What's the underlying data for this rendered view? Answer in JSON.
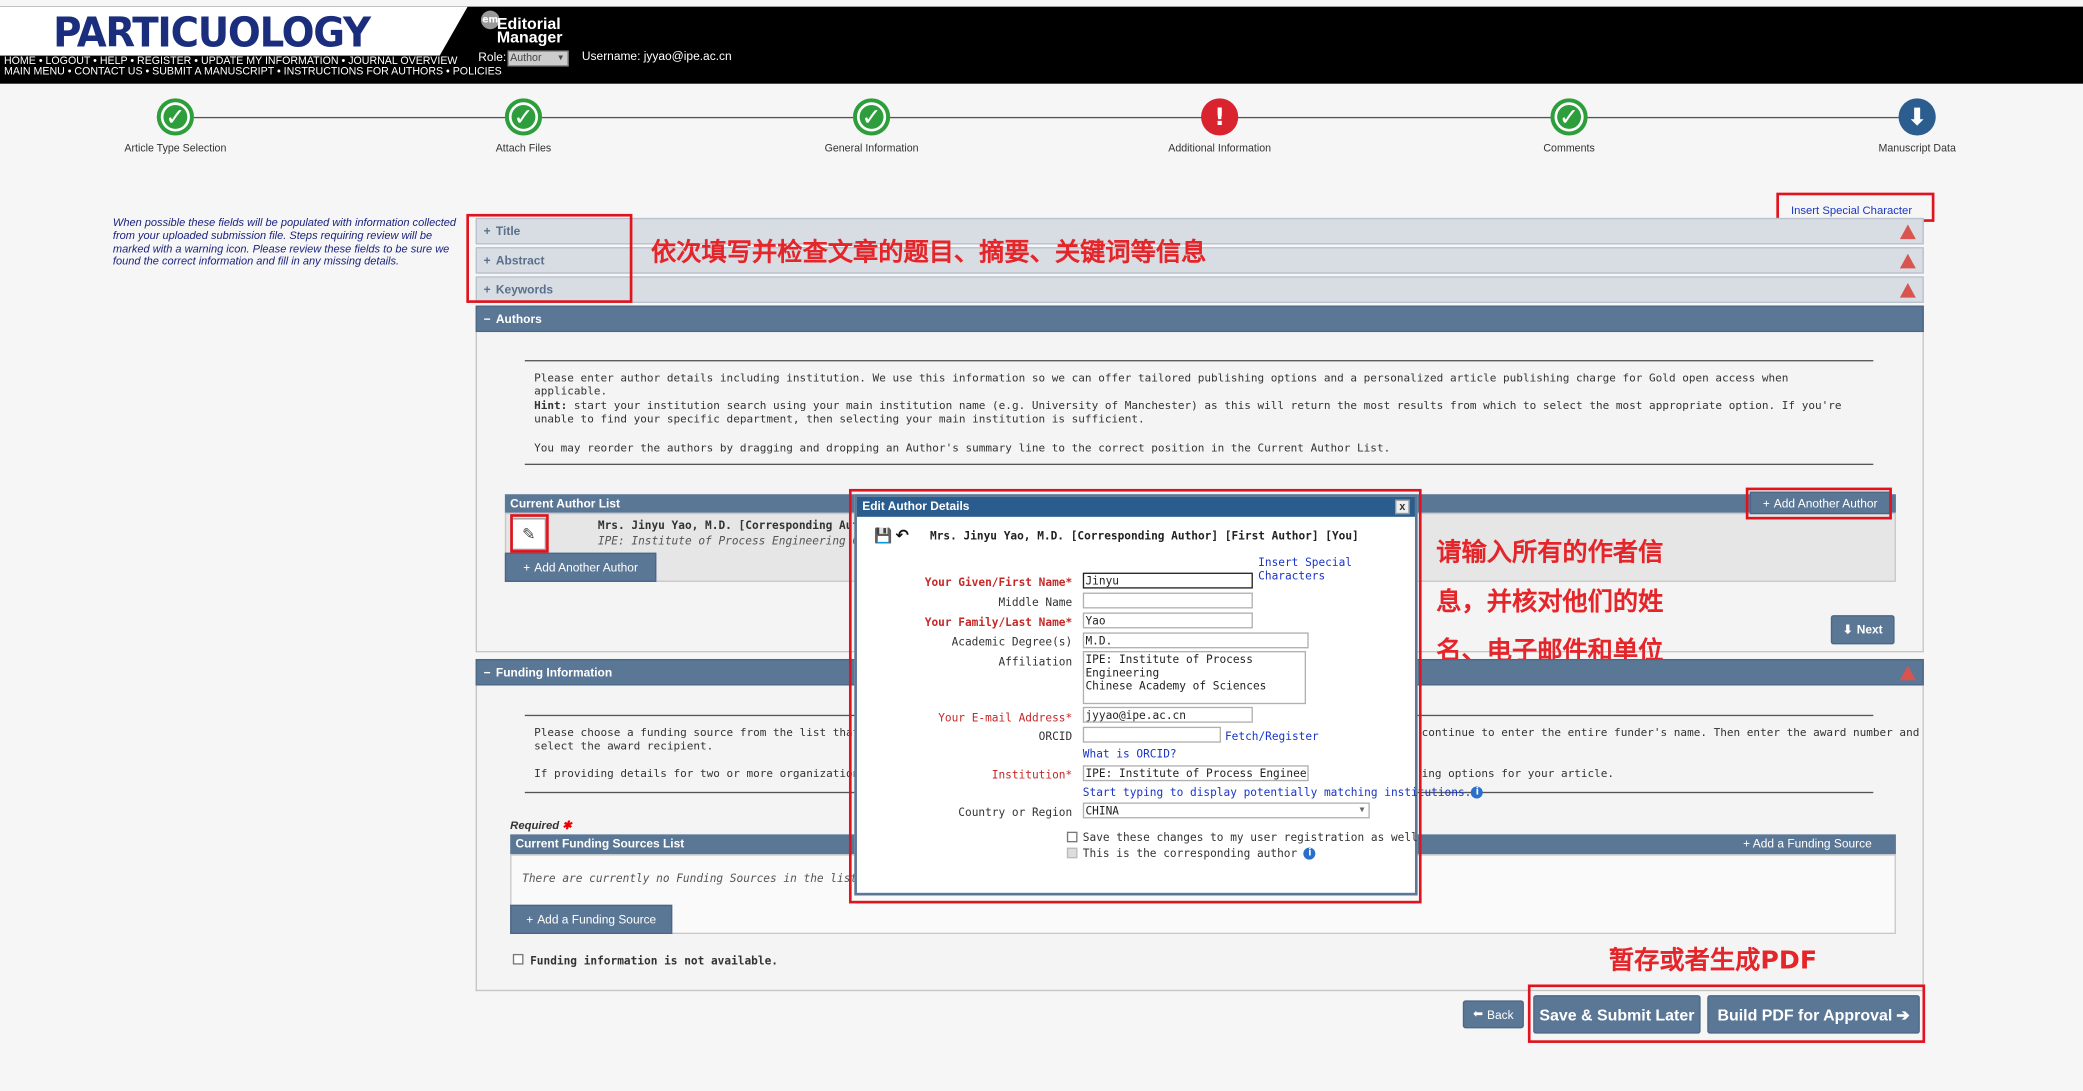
{
  "header": {
    "logo": "PARTICUOLOGY",
    "nav_line1": "HOME • LOGOUT • HELP • REGISTER • UPDATE MY INFORMATION • JOURNAL OVERVIEW",
    "nav_line2": "MAIN MENU • CONTACT US • SUBMIT A MANUSCRIPT • INSTRUCTIONS FOR AUTHORS • POLICIES",
    "em_icon": "em",
    "em_title": "Editorial Manager",
    "role_label": "Role:",
    "role_value": "Author",
    "username": "Username: jyyao@ipe.ac.cn"
  },
  "steps": [
    {
      "label": "Article Type Selection",
      "status": "complete",
      "icon": "check-icon"
    },
    {
      "label": "Attach Files",
      "status": "complete",
      "icon": "check-icon"
    },
    {
      "label": "General Information",
      "status": "complete",
      "icon": "check-icon"
    },
    {
      "label": "Additional Information",
      "status": "warning",
      "icon": "exclamation-icon"
    },
    {
      "label": "Comments",
      "status": "complete",
      "icon": "check-icon"
    },
    {
      "label": "Manuscript Data",
      "status": "current",
      "icon": "down-arrow-icon"
    }
  ],
  "note": "When possible these fields will be populated with information collected from your uploaded submission file. Steps requiring review will be marked with a warning icon. Please review these fields to be sure we found the correct information and fill in any missing details.",
  "insert_special": "Insert Special Character",
  "sections": {
    "title": "Title",
    "abstract": "Abstract",
    "keywords": "Keywords",
    "authors": "Authors",
    "funding": "Funding Information",
    "collapsed_sign": "+",
    "expanded_sign": "−"
  },
  "authors_panel": {
    "p1": "Please enter author details including institution. We use this information so we can offer tailored publishing options and a personalized article publishing charge for Gold open access when applicable.",
    "hint_label": "Hint:",
    "hint": "start your institution search using your main institution name (e.g. University of Manchester) as this will return the most results from which to select the most appropriate option. If you're unable to find your specific department, then selecting your main institution is sufficient.",
    "p3": "You may reorder the authors by dragging and dropping an Author's summary line to the correct position in the Current Author List.",
    "list_title": "Current Author List",
    "add_author_top": "Add Another Author",
    "author_name": "Mrs. Jinyu Yao, M.D. [Corresponding Aut",
    "author_inst": "IPE: Institute of Process Engineering Chinese",
    "add_author_bottom": "Add Another Author",
    "next": "Next"
  },
  "funding_panel": {
    "p1a": "Please choose a funding source from the list that display",
    "p1b": "select the award recipient.",
    "p1c": "continue to enter the entire funder's name. Then enter the award number and",
    "p2a": "If providing details for two or more organizations, please",
    "p2b": "ing options for your article.",
    "required": "Required",
    "list_title": "Current Funding Sources List",
    "add_top": "Add a Funding Source",
    "empty": "There are currently no Funding Sources in the list",
    "add_bottom": "Add a Funding Source",
    "not_available": "Funding information is not available."
  },
  "modal": {
    "title": "Edit Author Details",
    "close": "x",
    "heading": "Mrs. Jinyu Yao, M.D. [Corresponding Author] [First Author] [You]",
    "insert_special": "Insert Special Characters",
    "given_label": "Your Given/First Name*",
    "given_value": "Jinyu",
    "middle_label": "Middle Name",
    "middle_value": "",
    "family_label": "Your Family/Last Name*",
    "family_value": "Yao",
    "degree_label": "Academic Degree(s)",
    "degree_value": "M.D.",
    "affil_label": "Affiliation",
    "affil_line1": "IPE: Institute of Process Engineering",
    "affil_line2": "Chinese Academy of Sciences",
    "email_label": "Your E-mail Address*",
    "email_value": "jyyao@ipe.ac.cn",
    "orcid_label": "ORCID",
    "orcid_value": "",
    "fetch": "Fetch/Register",
    "what_orcid": "What is ORCID?",
    "inst_label": "Institution*",
    "inst_value": "IPE: Institute of Process Engineering Ch",
    "inst_hint": "Start typing to display potentially matching institutions.",
    "country_label": "Country or Region",
    "country_value": "CHINA",
    "save_changes": "Save these changes to my user registration as well",
    "corresponding": "This is the corresponding author"
  },
  "bottom": {
    "back": "Back",
    "save_later": "Save & Submit Later",
    "build_pdf": "Build PDF for Approval"
  },
  "annotations": {
    "a1": "依次填写并检查文章的题目、摘要、关键词等信息",
    "a2_line1": "请输入所有的作者信",
    "a2_line2": "息，并核对他们的姓",
    "a2_line3": "名、电子邮件和单位",
    "a3": "暂存或者生成PDF"
  },
  "colors": {
    "brand_blue": "#1b2e7e",
    "section_bar": "#5b7796",
    "modal_bar": "#2a5d8e",
    "success": "#2e9e3c",
    "warning": "#d9232e",
    "annotation_red": "#e0141e"
  }
}
